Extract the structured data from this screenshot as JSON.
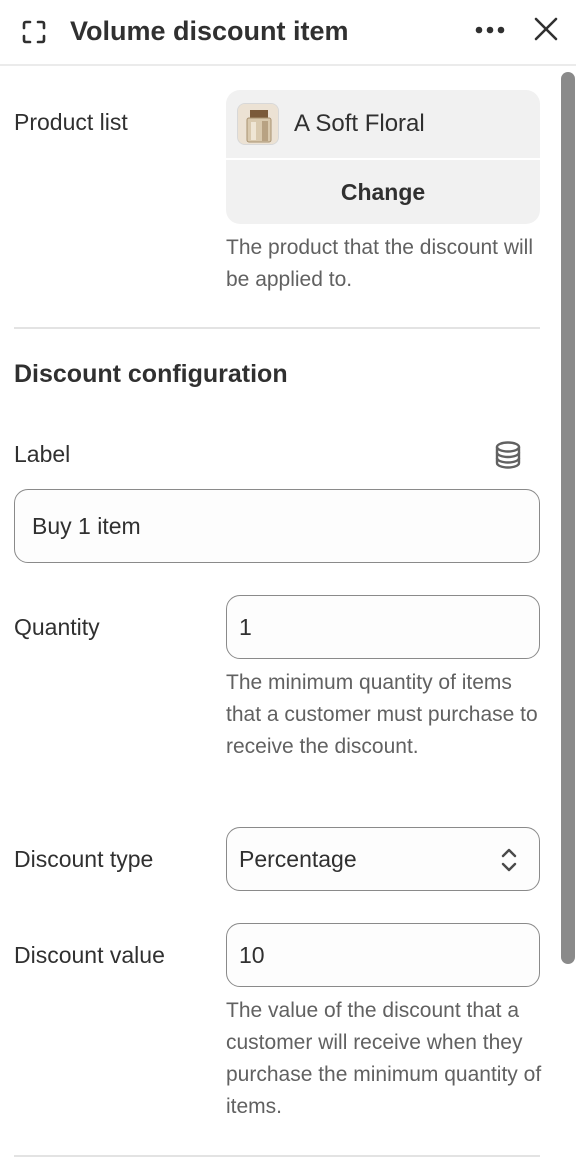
{
  "header": {
    "title": "Volume discount item",
    "expand_icon": "expand-icon",
    "more_icon": "more-horizontal-icon",
    "close_icon": "close-icon"
  },
  "product": {
    "label": "Product list",
    "name": "A Soft Floral",
    "change_label": "Change",
    "help": "The product that the discount will be applied to."
  },
  "config": {
    "title": "Discount configuration",
    "label_field": {
      "label": "Label",
      "value": "Buy 1 item",
      "icon": "database-icon"
    },
    "quantity": {
      "label": "Quantity",
      "value": "1",
      "help": "The minimum quantity of items that a customer must purchase to receive the discount."
    },
    "discount_type": {
      "label": "Discount type",
      "value": "Percentage"
    },
    "discount_value": {
      "label": "Discount value",
      "value": "10",
      "help": "The value of the discount that a customer will receive when they purchase the minimum quantity of items."
    }
  },
  "colors": {
    "text": "#303030",
    "muted_text": "#616161",
    "border": "#8a8a8a",
    "card_bg": "#f1f1f1",
    "scroll_thumb": "#8a8a8a"
  }
}
